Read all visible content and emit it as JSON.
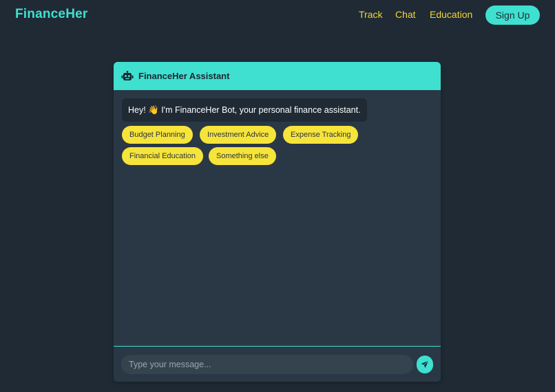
{
  "brand": "FinanceHer",
  "nav": {
    "links": [
      "Track",
      "Chat",
      "Education"
    ],
    "signup_label": "Sign Up"
  },
  "chat": {
    "title": "FinanceHer Assistant",
    "header_icon": "robot-icon",
    "greeting": "Hey! 👋 I'm FinanceHer Bot, your personal finance assistant.",
    "quick_replies": [
      "Budget Planning",
      "Investment Advice",
      "Expense Tracking",
      "Financial Education",
      "Something else"
    ],
    "input_placeholder": "Type your message...",
    "send_icon": "paper-plane-icon"
  },
  "colors": {
    "background": "#1f2a34",
    "accent_teal": "#3fe0d0",
    "accent_yellow": "#f7e43a",
    "chat_body": "#2a3845"
  }
}
